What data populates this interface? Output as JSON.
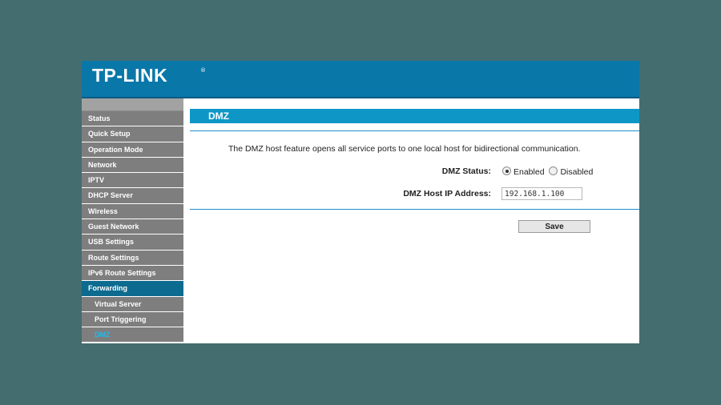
{
  "brand": {
    "logo_text": "TP-LINK",
    "logo_mark": "®"
  },
  "sidebar": {
    "items": [
      {
        "label": "Status"
      },
      {
        "label": "Quick Setup"
      },
      {
        "label": "Operation Mode"
      },
      {
        "label": "Network"
      },
      {
        "label": "IPTV"
      },
      {
        "label": "DHCP Server"
      },
      {
        "label": "Wireless"
      },
      {
        "label": "Guest Network"
      },
      {
        "label": "USB Settings"
      },
      {
        "label": "Route Settings"
      },
      {
        "label": "IPv6 Route Settings"
      },
      {
        "label": "Forwarding",
        "active": true
      },
      {
        "label": "Virtual Server",
        "sub": true
      },
      {
        "label": "Port Triggering",
        "sub": true
      },
      {
        "label": "DMZ",
        "sub": true,
        "current": true
      }
    ]
  },
  "page": {
    "title": "DMZ",
    "description": "The DMZ host feature opens all service ports to one local host for bidirectional communication.",
    "status_label": "DMZ Status:",
    "status_options": [
      "Enabled",
      "Disabled"
    ],
    "status_selected": "Enabled",
    "ip_label": "DMZ Host IP Address:",
    "ip_value": "192.168.1.100",
    "save_label": "Save"
  },
  "colors": {
    "header": "#0a77a9",
    "title_bar": "#0e97c6",
    "nav_item": "#7e7e7e",
    "nav_active": "#0d6b8f",
    "nav_current_text": "#25b7e8",
    "backdrop": "#446d70"
  }
}
